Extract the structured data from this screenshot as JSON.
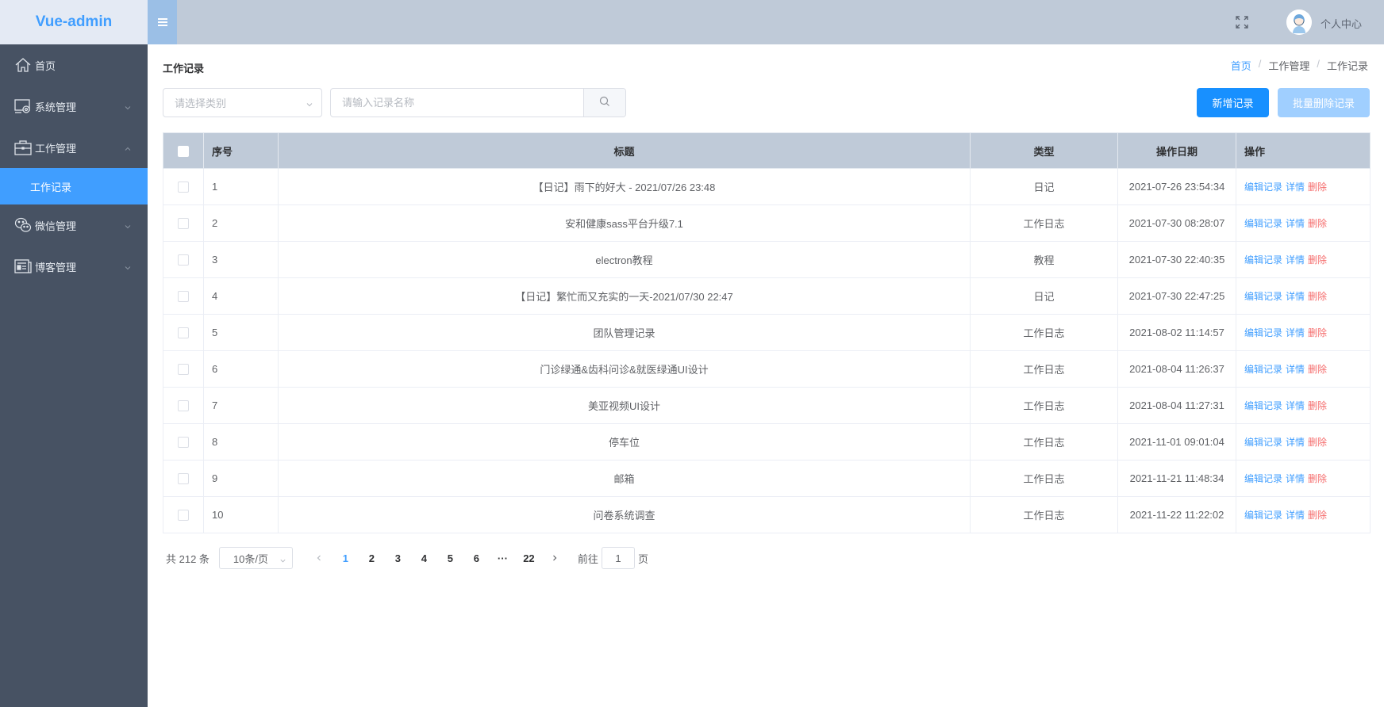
{
  "app": {
    "logo": "Vue-admin"
  },
  "header": {
    "user_label": "个人中心"
  },
  "sidebar": {
    "items": [
      {
        "label": "首页",
        "icon": "home-icon",
        "expandable": false
      },
      {
        "label": "系统管理",
        "icon": "system-settings-icon",
        "expandable": true,
        "expanded": false
      },
      {
        "label": "工作管理",
        "icon": "briefcase-icon",
        "expandable": true,
        "expanded": true,
        "children": [
          {
            "label": "工作记录",
            "active": true
          }
        ]
      },
      {
        "label": "微信管理",
        "icon": "wechat-icon",
        "expandable": true,
        "expanded": false
      },
      {
        "label": "博客管理",
        "icon": "blog-icon",
        "expandable": true,
        "expanded": false
      }
    ]
  },
  "page": {
    "title": "工作记录",
    "breadcrumb": [
      "首页",
      "工作管理",
      "工作记录"
    ]
  },
  "filters": {
    "category_placeholder": "请选择类别",
    "search_placeholder": "请输入记录名称",
    "search_value": ""
  },
  "actions": {
    "add_label": "新增记录",
    "batch_delete_label": "批量删除记录"
  },
  "table": {
    "columns": [
      "序号",
      "标题",
      "类型",
      "操作日期",
      "操作"
    ],
    "row_actions": {
      "edit": "编辑记录",
      "detail": "详情",
      "delete": "删除"
    },
    "rows": [
      {
        "index": "1",
        "title": "【日记】雨下的好大 - 2021/07/26 23:48",
        "type": "日记",
        "date": "2021-07-26 23:54:34"
      },
      {
        "index": "2",
        "title": "安和健康sass平台升级7.1",
        "type": "工作日志",
        "date": "2021-07-30 08:28:07"
      },
      {
        "index": "3",
        "title": "electron教程",
        "type": "教程",
        "date": "2021-07-30 22:40:35"
      },
      {
        "index": "4",
        "title": "【日记】繁忙而又充实的一天-2021/07/30 22:47",
        "type": "日记",
        "date": "2021-07-30 22:47:25"
      },
      {
        "index": "5",
        "title": "团队管理记录",
        "type": "工作日志",
        "date": "2021-08-02 11:14:57"
      },
      {
        "index": "6",
        "title": "门诊绿通&齿科问诊&就医绿通UI设计",
        "type": "工作日志",
        "date": "2021-08-04 11:26:37"
      },
      {
        "index": "7",
        "title": "美亚视频UI设计",
        "type": "工作日志",
        "date": "2021-08-04 11:27:31"
      },
      {
        "index": "8",
        "title": "停车位",
        "type": "工作日志",
        "date": "2021-11-01 09:01:04"
      },
      {
        "index": "9",
        "title": "邮箱",
        "type": "工作日志",
        "date": "2021-11-21 11:48:34"
      },
      {
        "index": "10",
        "title": "问卷系统调查",
        "type": "工作日志",
        "date": "2021-11-22 11:22:02"
      }
    ]
  },
  "pagination": {
    "total_label": "共 212 条",
    "page_size_label": "10条/页",
    "pages": [
      "1",
      "2",
      "3",
      "4",
      "5",
      "6",
      "···",
      "22"
    ],
    "current_page": "1",
    "jumper_prefix": "前往",
    "jumper_value": "1",
    "jumper_suffix": "页"
  },
  "colors": {
    "primary": "#409eff",
    "sidebar_bg": "#475263",
    "header_bg": "#bfcad8",
    "danger": "#f56c6c"
  }
}
